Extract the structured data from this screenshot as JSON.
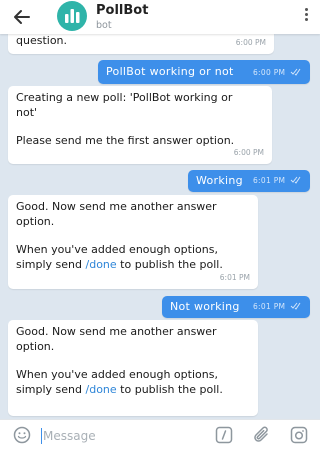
{
  "header": {
    "title": "PollBot",
    "subtitle": "bot"
  },
  "messages": [
    {
      "dir": "in",
      "lines": [
        "question."
      ],
      "time": "6:00 PM"
    },
    {
      "dir": "out",
      "lines": [
        "PollBot working or not"
      ],
      "time": "6:00 PM"
    },
    {
      "dir": "in",
      "line1": "Creating a new poll: 'PollBot working or",
      "line2": "not'",
      "line3": "Please send me the first answer option.",
      "time": "6:00 PM"
    },
    {
      "dir": "out",
      "lines": [
        "Working"
      ],
      "time": "6:01 PM"
    },
    {
      "dir": "in",
      "line1": "Good. Now send me another answer",
      "line2": "option.",
      "line3": "When you've added enough options,",
      "line4_pre": "simply send ",
      "line4_cmd": "/done",
      "line4_post": " to publish the poll.",
      "time": "6:01 PM"
    },
    {
      "dir": "out",
      "lines": [
        "Not working"
      ],
      "time": "6:01 PM"
    },
    {
      "dir": "in",
      "line1": "Good. Now send me another answer",
      "line2": "option.",
      "line3": "When you've added enough options,",
      "line4_pre": "simply send ",
      "line4_cmd": "/done",
      "line4_post": " to publish the poll.",
      "time": "6:01 PM"
    }
  ],
  "input": {
    "placeholder": "Message"
  },
  "colors": {
    "background": "#dde6ef",
    "outgoing_bubble": "#3d8fea",
    "incoming_bubble": "#ffffff",
    "avatar": "#2fb4a9",
    "link": "#2f86d8"
  },
  "icons": {
    "back": "arrow-left-icon",
    "avatar": "bar-chart-icon",
    "menu": "more-vertical-icon",
    "emoji": "smiley-icon",
    "command": "slash-command-icon",
    "attach": "paperclip-icon",
    "camera": "camera-icon",
    "read": "double-check-icon"
  }
}
